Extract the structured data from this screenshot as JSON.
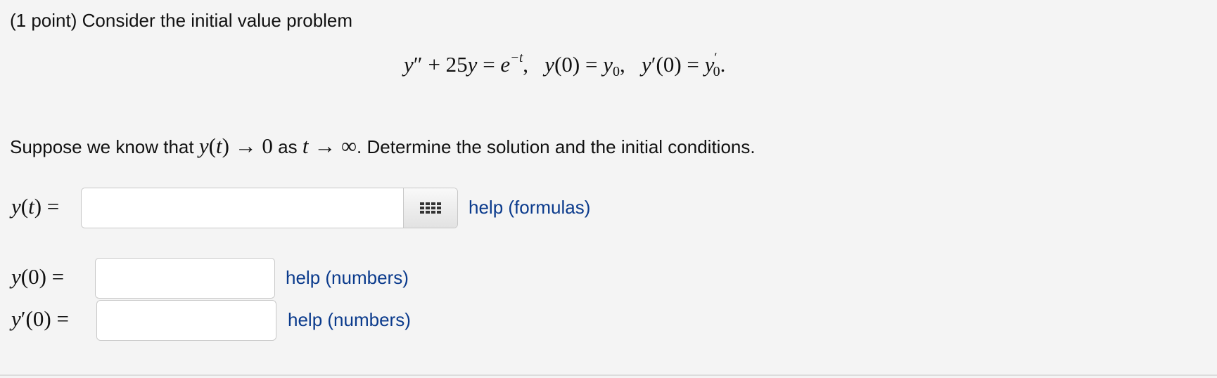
{
  "header": {
    "points": "(1 point)",
    "intro": "Consider the initial value problem"
  },
  "equation": {
    "lhs_y": "y",
    "lhs_prime": "″",
    "plus": " + 25",
    "lhs_y2": "y",
    "eq": " = ",
    "exp_base": "e",
    "exp_pow": "−t",
    "sep1": ",   ",
    "ic1": "y",
    "ic1_arg": "(0) = ",
    "ic1_val": "y",
    "ic1_sub": "0",
    "sep2": ",   ",
    "ic2": "y",
    "ic2_prime": "′",
    "ic2_arg": "(0) = ",
    "ic2_val": "y",
    "ic2_valprime": "′",
    "ic2_sub": "0",
    "end": "."
  },
  "condition": {
    "prefix": "Suppose we know that ",
    "y": "y",
    "t_paren_open": "(",
    "t": "t",
    "t_paren_close": ")",
    "arrow1": " → 0",
    "as": " as ",
    "t2": "t",
    "arrow2": " → ∞",
    "suffix": ". Determine the solution and the initial conditions."
  },
  "answers": {
    "yt": {
      "label_y": "y",
      "label_open": "(",
      "label_t": "t",
      "label_close": ") =",
      "value": "",
      "help": "help (formulas)"
    },
    "y0": {
      "label_y": "y",
      "label_rest": "(0) =",
      "value": "",
      "help": "help (numbers)"
    },
    "yp0": {
      "label_y": "y",
      "label_prime": "′",
      "label_rest": "(0) =",
      "value": "",
      "help": "help (numbers)"
    }
  },
  "icons": {
    "equation_editor": "grid-icon"
  },
  "colors": {
    "background": "#f4f4f4",
    "link": "#0a3a8c"
  }
}
